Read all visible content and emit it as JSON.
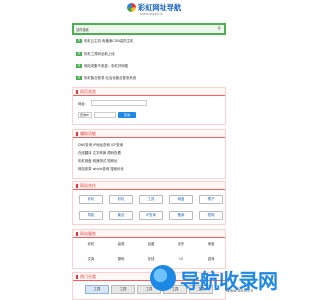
{
  "header": {
    "logo_text": "彩虹网址导航",
    "logo_url": "www.ceggd.cn"
  },
  "search": {
    "category": "站内搜索",
    "placeholder": "",
    "button_icon": "search-icon"
  },
  "news": [
    {
      "tag": "新",
      "text": "彩虹云主机-免备案CDN高防主机"
    },
    {
      "tag": "新",
      "text": "彩虹工具网全新上线"
    },
    {
      "tag": "新",
      "text": "网站采集不收费 - 彩虹好网推"
    },
    {
      "tag": "新",
      "text": "彩虹聚合登录-社会化聚合登录系统"
    }
  ],
  "sections": {
    "browser": {
      "title": "网页浏览",
      "url_label": "网址:",
      "ip_select": "查询IP",
      "ip_button": "查询"
    },
    "help": {
      "title": "辅助功能",
      "lines": [
        "DNS查询 IP地址查询 ICP查询",
        "在线翻译 文字转换 源码查看",
        "彩虹网盘 网速测试 短网址",
        "网站收录 whois查询 搜索优化"
      ]
    },
    "friends": {
      "title": "网站合作",
      "row1": [
        "彩虹",
        "彩虹",
        "工具",
        "网盘",
        "橘子"
      ],
      "row2": [
        "导航",
        "聚合",
        "IP查询",
        "备案",
        "短网"
      ]
    },
    "entertain": {
      "title": "网站服务",
      "row1": [
        "彩虹",
        "高德",
        "百度",
        "京东",
        "淘宝"
      ],
      "row2": [
        "文库",
        "源码",
        "在线",
        "UI",
        "游戏"
      ]
    },
    "category": {
      "title": "热门分类",
      "tabs": [
        "工具",
        "工具",
        "工具",
        "工具",
        "工具"
      ]
    }
  },
  "watermark": {
    "text": "导航收录网",
    "url": "www.dhsl.cn"
  }
}
